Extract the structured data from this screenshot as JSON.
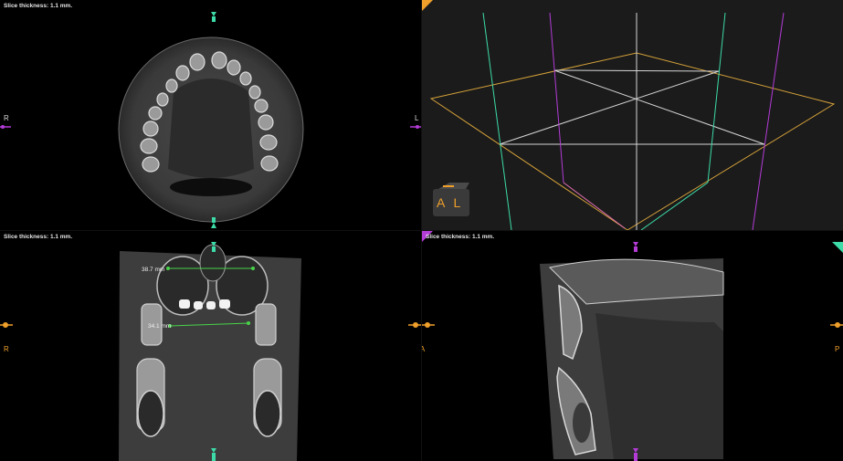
{
  "viewports": {
    "axial": {
      "slice_thickness": "Slice thickness: 1.1 mm.",
      "left_label": "R",
      "right_label": "L"
    },
    "three_d": {
      "cube_labels": "A L"
    },
    "coronal": {
      "slice_thickness": "Slice thickness: 1.1 mm.",
      "left_label": "R",
      "measurements": [
        {
          "value": "38.7 mm"
        },
        {
          "value": "34.1 mm"
        }
      ]
    },
    "sagittal": {
      "slice_thickness": "Slice thickness: 1.1 mm.",
      "left_label": "L A",
      "right_label": "P"
    }
  },
  "colors": {
    "axial_marker": "#3ddba8",
    "coronal_marker": "#b33bd6",
    "sagittal_marker": "#f0a02a",
    "measure_line": "#48d34a"
  }
}
